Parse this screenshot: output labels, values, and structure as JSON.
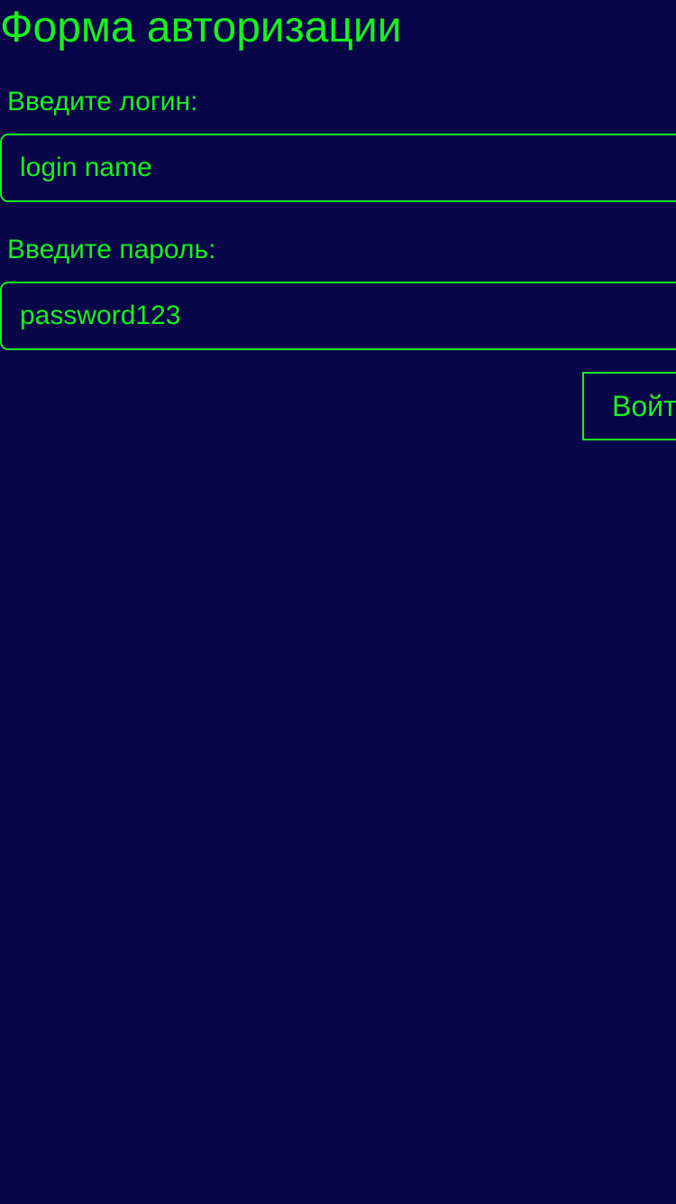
{
  "theme": {
    "background": "#080648",
    "accent": "#19f01e"
  },
  "form": {
    "title": "Форма авторизации",
    "login": {
      "label": "Введите логин:",
      "value": "login name"
    },
    "password": {
      "label": "Введите пароль:",
      "value": "password123"
    },
    "submit_label": "Войти"
  }
}
